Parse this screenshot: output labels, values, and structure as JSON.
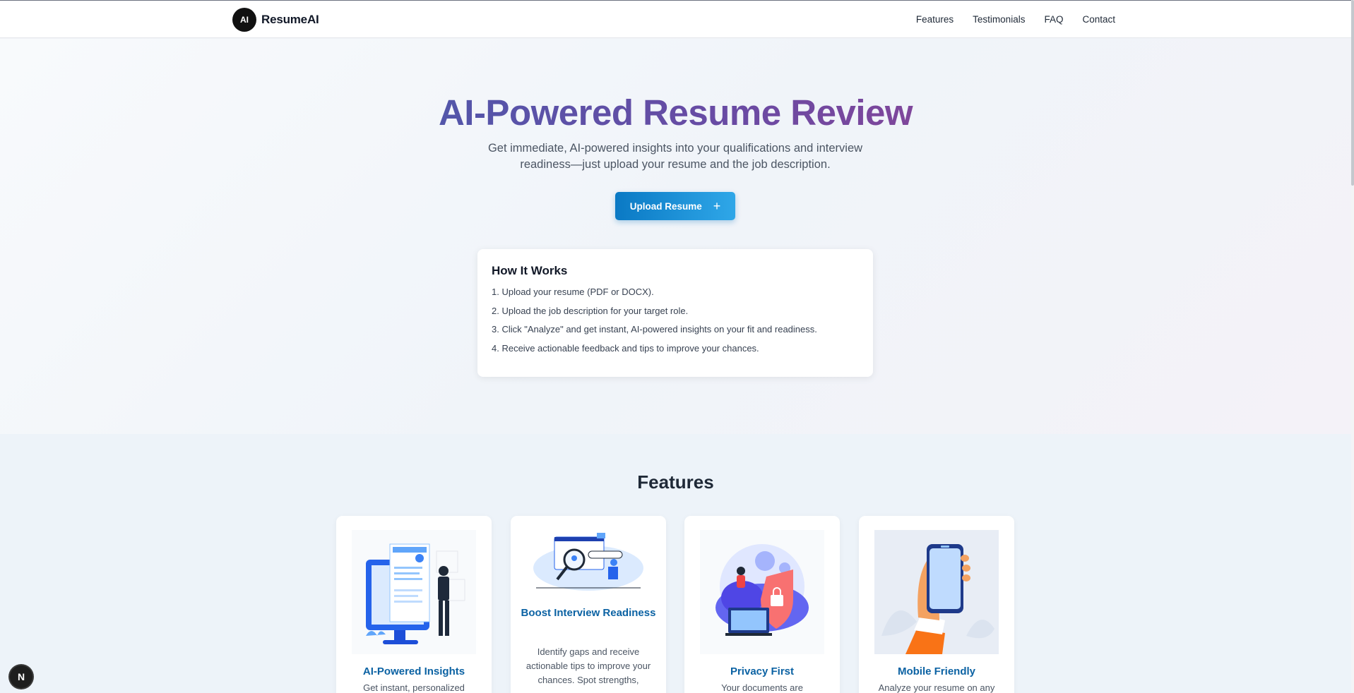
{
  "header": {
    "logo_text": "AI",
    "brand_name": "ResumeAI",
    "nav": [
      "Features",
      "Testimonials",
      "FAQ",
      "Contact"
    ]
  },
  "hero": {
    "title": "AI-Powered Resume Review",
    "subtitle": "Get immediate, AI-powered insights into your qualifications and interview readiness—just upload your resume and the job description.",
    "upload_label": "Upload Resume",
    "upload_icon": "+"
  },
  "how_it_works": {
    "title": "How It Works",
    "steps": [
      "1. Upload your resume (PDF or DOCX).",
      "2. Upload the job description for your target role.",
      "3. Click \"Analyze\" and get instant, AI-powered insights on your fit and readiness.",
      "4. Receive actionable feedback and tips to improve your chances."
    ]
  },
  "features": {
    "title": "Features",
    "cards": [
      {
        "title": "AI-Powered Insights",
        "description": "Get instant, personalized",
        "illustration": "resume-screen-illustration"
      },
      {
        "title": "Boost Interview Readiness",
        "description": "Identify gaps and receive actionable tips to improve your chances. Spot strengths,",
        "illustration": "magnifier-analysis-illustration"
      },
      {
        "title": "Privacy First",
        "description": "Your documents are",
        "illustration": "shield-lock-illustration"
      },
      {
        "title": "Mobile Friendly",
        "description": "Analyze your resume on any",
        "illustration": "phone-in-hand-illustration"
      }
    ]
  },
  "badge": {
    "label": "N"
  },
  "colors": {
    "accent": "#0b62a3",
    "button_start": "#0a79c4",
    "button_end": "#2fa7e8",
    "title_gradient": [
      "#3267b3",
      "#6a4aa3",
      "#b33d86"
    ]
  }
}
